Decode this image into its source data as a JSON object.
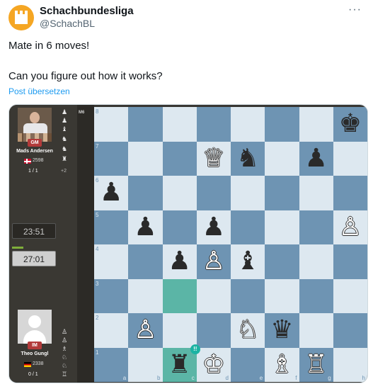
{
  "tweet": {
    "display_name": "Schachbundesliga",
    "handle": "@SchachBL",
    "more_label": "···",
    "line1": "Mate in 6 moves!",
    "line2": "Can you figure out how it works?",
    "translate_label": "Post übersetzen",
    "avatar_icon": "chess-rook-logo-icon"
  },
  "game": {
    "move_tag": "M6",
    "player_black": {
      "name": "Mads Andersen",
      "title": "GM",
      "rating": "2598",
      "country_flag": "denmark-flag-icon",
      "score": "1 / 1",
      "captured": [
        "♟",
        "♟",
        "♝",
        "♞",
        "♜"
      ],
      "material_diff": "+2"
    },
    "player_white": {
      "name": "Theo Gungl",
      "title": "IM",
      "rating": "2338",
      "country_flag": "germany-flag-icon",
      "score": "0 / 1",
      "captured": [
        "♙",
        "♙",
        "♗",
        "♘",
        "♖"
      ]
    },
    "clock_black": "23:51",
    "clock_white": "27:01",
    "colors": {
      "light_square": "#dde8f0",
      "dark_square": "#6e94b3",
      "highlight": "#5bb5a6",
      "title_badge": "#b23a3a"
    }
  },
  "board": {
    "ranks": [
      "8",
      "7",
      "6",
      "5",
      "4",
      "3",
      "2",
      "1"
    ],
    "files": [
      "a",
      "b",
      "c",
      "d",
      "e",
      "f",
      "g",
      "h"
    ],
    "highlighted_squares": [
      "c3",
      "c1"
    ],
    "brilliant_marker": "!!",
    "brilliant_square": "c1",
    "pieces": [
      {
        "square": "h8",
        "symbol": "♚",
        "color": "black",
        "name": "black-king"
      },
      {
        "square": "d7",
        "symbol": "♕",
        "color": "white",
        "name": "white-queen"
      },
      {
        "square": "e7",
        "symbol": "♞",
        "color": "black",
        "name": "black-knight"
      },
      {
        "square": "g7",
        "symbol": "♟",
        "color": "black",
        "name": "black-pawn"
      },
      {
        "square": "a6",
        "symbol": "♟",
        "color": "black",
        "name": "black-pawn"
      },
      {
        "square": "b5",
        "symbol": "♟",
        "color": "black",
        "name": "black-pawn"
      },
      {
        "square": "d5",
        "symbol": "♟",
        "color": "black",
        "name": "black-pawn"
      },
      {
        "square": "h5",
        "symbol": "♙",
        "color": "white",
        "name": "white-pawn"
      },
      {
        "square": "c4",
        "symbol": "♟",
        "color": "black",
        "name": "black-pawn"
      },
      {
        "square": "d4",
        "symbol": "♙",
        "color": "white",
        "name": "white-pawn"
      },
      {
        "square": "e4",
        "symbol": "♝",
        "color": "black",
        "name": "black-bishop"
      },
      {
        "square": "b2",
        "symbol": "♙",
        "color": "white",
        "name": "white-pawn"
      },
      {
        "square": "e2",
        "symbol": "♘",
        "color": "white",
        "name": "white-knight"
      },
      {
        "square": "f2",
        "symbol": "♛",
        "color": "black",
        "name": "black-queen"
      },
      {
        "square": "c1",
        "symbol": "♜",
        "color": "black",
        "name": "black-rook"
      },
      {
        "square": "d1",
        "symbol": "♔",
        "color": "white",
        "name": "white-king"
      },
      {
        "square": "f1",
        "symbol": "♗",
        "color": "white",
        "name": "white-bishop"
      },
      {
        "square": "g1",
        "symbol": "♖",
        "color": "white",
        "name": "white-rook"
      }
    ]
  }
}
